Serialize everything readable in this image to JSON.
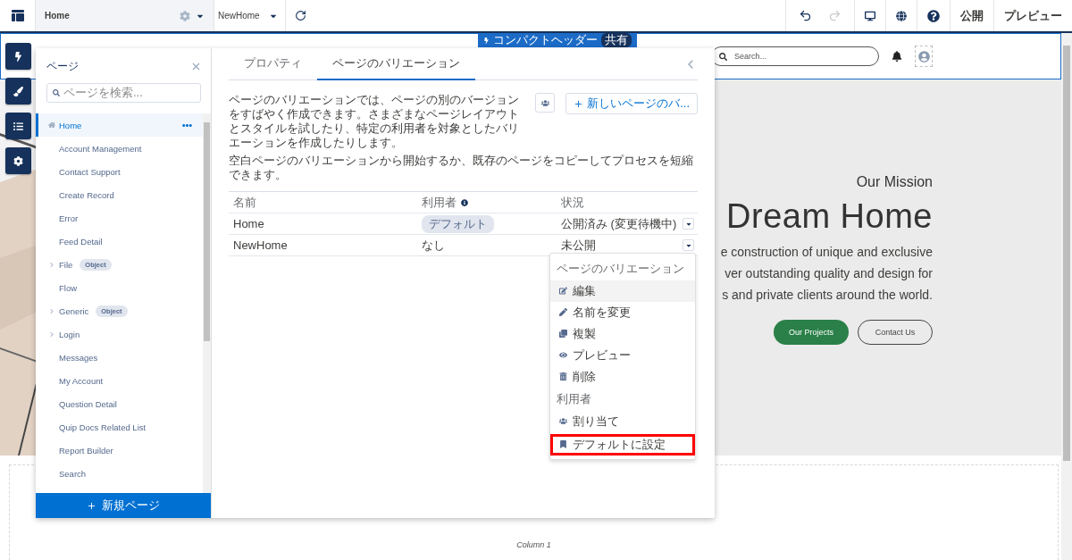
{
  "top_bar": {
    "page_selector": {
      "label": "Home"
    },
    "variation_selector": {
      "label": "NewHome"
    },
    "tools": [
      {
        "kind": "undo",
        "disabled": false
      },
      {
        "kind": "redo",
        "disabled": true
      },
      {
        "kind": "desktop",
        "disabled": false
      },
      {
        "kind": "globe",
        "disabled": false
      },
      {
        "kind": "help",
        "disabled": false
      }
    ],
    "actions": [
      "公開",
      "プレビュー"
    ]
  },
  "component_tag": {
    "label": "コンパクトヘッダー",
    "badge": "共有"
  },
  "site": {
    "search": {
      "placeholder": "Search..."
    },
    "hero": {
      "eyebrow": "Our Mission",
      "title": "Dream Home",
      "lines": [
        "e construction of unique and exclusive",
        "ver outstanding quality and design for",
        "s and private clients around the world."
      ],
      "buttons": [
        {
          "label": "Our Projects",
          "kind": "primary"
        },
        {
          "label": "Contact Us",
          "kind": "outline"
        }
      ]
    },
    "column": {
      "label": "Column 1"
    }
  },
  "pages_panel": {
    "title": "ページ",
    "search": {
      "placeholder": "ページを検索..."
    },
    "items": [
      {
        "label": "Home",
        "kind": "home",
        "selected": true
      },
      {
        "label": "Account Management",
        "kind": "page",
        "selected": false
      },
      {
        "label": "Contact Support",
        "kind": "page",
        "selected": false
      },
      {
        "label": "Create Record",
        "kind": "page",
        "selected": false
      },
      {
        "label": "Error",
        "kind": "page",
        "selected": false
      },
      {
        "label": "Feed Detail",
        "kind": "page",
        "selected": false
      },
      {
        "label": "File",
        "kind": "group",
        "badge": "Object",
        "selected": false
      },
      {
        "label": "Flow",
        "kind": "page",
        "selected": false
      },
      {
        "label": "Generic",
        "kind": "group",
        "badge": "Object",
        "selected": false
      },
      {
        "label": "Login",
        "kind": "group",
        "selected": false
      },
      {
        "label": "Messages",
        "kind": "page",
        "selected": false
      },
      {
        "label": "My Account",
        "kind": "page",
        "selected": false
      },
      {
        "label": "Question Detail",
        "kind": "page",
        "selected": false
      },
      {
        "label": "Quip Docs Related List",
        "kind": "page",
        "selected": false
      },
      {
        "label": "Report Builder",
        "kind": "page",
        "selected": false
      },
      {
        "label": "Search",
        "kind": "page",
        "selected": false
      }
    ],
    "new_button": "新規ページ"
  },
  "properties_panel": {
    "tabs": [
      {
        "label": "プロパティ",
        "selected": false
      },
      {
        "label": "ページのバリエーション",
        "selected": true
      }
    ],
    "description": [
      "ページのバリエーションでは、ページの別のバージョンをすばやく作成できます。さまざまなページレイアウトとスタイルを試したり、特定の利用者を対象としたバリエーションを作成したりします。",
      "空白ページのバリエーションから開始するか、既存のページをコピーしてプロセスを短縮できます。"
    ],
    "new_variation_button": "新しいページのバ...",
    "table": {
      "columns": [
        "名前",
        "利用者",
        "状況"
      ],
      "rows": [
        {
          "name": "Home",
          "audience": {
            "label": "デフォルト",
            "kind": "badge"
          },
          "status": "公開済み (変更待機中)"
        },
        {
          "name": "NewHome",
          "audience": {
            "label": "なし",
            "kind": "text"
          },
          "status": "未公開",
          "menu": [
            {
              "kind": "header",
              "label": "ページのバリエーション"
            },
            {
              "kind": "edit",
              "label": "編集",
              "highlighted": true,
              "outlined": false
            },
            {
              "kind": "rename",
              "label": "名前を変更",
              "highlighted": false,
              "outlined": false
            },
            {
              "kind": "clone",
              "label": "複製",
              "highlighted": false,
              "outlined": false
            },
            {
              "kind": "preview",
              "label": "プレビュー",
              "highlighted": false,
              "outlined": false
            },
            {
              "kind": "delete",
              "label": "削除",
              "highlighted": false,
              "outlined": false
            },
            {
              "kind": "header",
              "label": "利用者"
            },
            {
              "kind": "assign",
              "label": "割り当て",
              "highlighted": false,
              "outlined": false
            },
            {
              "kind": "default",
              "label": "デフォルトに設定",
              "highlighted": false,
              "outlined": true
            }
          ]
        }
      ]
    }
  }
}
